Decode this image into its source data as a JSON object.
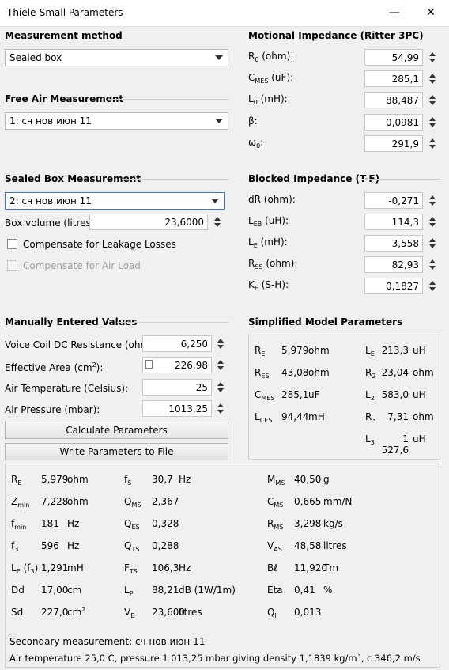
{
  "window": {
    "title": "Thiele-Small Parameters",
    "minimize_glyph": "—",
    "close_glyph": "✕"
  },
  "measurement_method": {
    "header": "Measurement method",
    "selected": "Sealed box"
  },
  "free_air": {
    "header": "Free Air Measurement",
    "selected": "1: сч нов июн 11"
  },
  "sealed_box": {
    "header": "Sealed Box Measurement",
    "selected": "2: сч нов июн 11",
    "box_volume_label": "Box volume (litres):",
    "box_volume_value": "23,6000",
    "compensate_leakage": "Compensate for Leakage Losses",
    "compensate_air": "Compensate for Air Load"
  },
  "motional": {
    "header": "Motional Impedance (Ritter 3PC)",
    "rows": [
      {
        "sym": "R",
        "sub": "0",
        "unit": " (ohm):",
        "value": "54,99"
      },
      {
        "sym": "C",
        "sub": "MES",
        "unit": " (uF):",
        "value": "285,1"
      },
      {
        "sym": "L",
        "sub": "0",
        "unit": " (mH):",
        "value": "88,487"
      },
      {
        "sym": "β:",
        "sub": "",
        "unit": "",
        "value": "0,0981"
      },
      {
        "sym": "ω",
        "sub": "0",
        "unit": ":",
        "value": "291,9"
      }
    ]
  },
  "blocked": {
    "header": "Blocked Impedance (T-F)",
    "rows": [
      {
        "sym": "dR (ohm):",
        "sub": "",
        "unit": "",
        "value": "-0,271"
      },
      {
        "sym": "L",
        "sub": "EB",
        "unit": " (uH):",
        "value": "114,3"
      },
      {
        "sym": "L",
        "sub": "E",
        "unit": " (mH):",
        "value": "3,558"
      },
      {
        "sym": "R",
        "sub": "SS",
        "unit": " (ohm):",
        "value": "82,93"
      },
      {
        "sym": "K",
        "sub": "E",
        "unit": " (S-H):",
        "value": "0,1827"
      }
    ]
  },
  "manual": {
    "header": "Manually Entered Values",
    "rows": [
      {
        "label": "Voice Coil DC Resistance (ohm):",
        "value": "6,250"
      },
      {
        "label_pre": "Effective Area (cm",
        "label_sup": "2",
        "label_post": "):",
        "value": "226,98"
      },
      {
        "label": "Air Temperature (Celsius):",
        "value": "25"
      },
      {
        "label": "Air Pressure (mbar):",
        "value": "1013,25"
      }
    ],
    "calc_button": "Calculate Parameters",
    "write_button": "Write Parameters to File"
  },
  "simplified": {
    "header": "Simplified Model Parameters",
    "left": [
      {
        "sym": "R",
        "sub": "E",
        "value": "5,979",
        "unit": "ohm"
      },
      {
        "sym": "R",
        "sub": "ES",
        "value": "43,08",
        "unit": "ohm"
      },
      {
        "sym": "C",
        "sub": "MES",
        "value": "285,1",
        "unit": "uF"
      },
      {
        "sym": "L",
        "sub": "CES",
        "value": "94,44",
        "unit": "mH"
      }
    ],
    "right": [
      {
        "sym": "L",
        "sub": "E",
        "value": "213,3",
        "unit": "uH"
      },
      {
        "sym": "R",
        "sub": "2",
        "value": "23,04",
        "unit": "ohm"
      },
      {
        "sym": "L",
        "sub": "2",
        "value": "583,0",
        "unit": "uH"
      },
      {
        "sym": "R",
        "sub": "3",
        "value": "7,31",
        "unit": "ohm"
      },
      {
        "sym": "L",
        "sub": "3",
        "value": "1 527,6",
        "unit": "uH"
      }
    ]
  },
  "results": {
    "col1": [
      {
        "sym": "R",
        "sub": "E",
        "value": "5,979",
        "unit": "ohm"
      },
      {
        "sym": "Z",
        "sub": "min",
        "value": "7,228",
        "unit": "ohm"
      },
      {
        "sym": "f",
        "sub": "min",
        "value": "181",
        "unit": "Hz"
      },
      {
        "sym": "f",
        "sub": "3",
        "value": "596",
        "unit": "Hz"
      },
      {
        "sym": "L",
        "sub": "E",
        "extra": " (f",
        "extra_sub": "3",
        "extra_post": ")",
        "value": "1,291",
        "unit": "mH"
      },
      {
        "sym": "Dd",
        "sub": "",
        "value": "17,00",
        "unit": "cm"
      },
      {
        "sym": "Sd",
        "sub": "",
        "value": "227,0",
        "unit": "cm",
        "unit_sup": "2"
      }
    ],
    "col2": [
      {
        "sym": "f",
        "sub": "S",
        "value": "30,7",
        "unit": "Hz"
      },
      {
        "sym": "Q",
        "sub": "MS",
        "value": "2,367",
        "unit": ""
      },
      {
        "sym": "Q",
        "sub": "ES",
        "value": "0,328",
        "unit": ""
      },
      {
        "sym": "Q",
        "sub": "TS",
        "value": "0,288",
        "unit": ""
      },
      {
        "sym": "F",
        "sub": "TS",
        "value": "106,3",
        "unit": "Hz"
      },
      {
        "sym": "L",
        "sub": "P",
        "value": "88,21",
        "unit": "dB (1W/1m)"
      },
      {
        "sym": "V",
        "sub": "B",
        "value": "23,600",
        "unit": "litres"
      }
    ],
    "col3": [
      {
        "sym": "M",
        "sub": "MS",
        "value": "40,50",
        "unit": "g"
      },
      {
        "sym": "C",
        "sub": "MS",
        "value": "0,665",
        "unit": "mm/N"
      },
      {
        "sym": "R",
        "sub": "MS",
        "value": "3,298",
        "unit": "kg/s"
      },
      {
        "sym": "V",
        "sub": "AS",
        "value": "48,58",
        "unit": "litres"
      },
      {
        "sym": "Bℓ",
        "sub": "",
        "value": "11,920",
        "unit": "Tm"
      },
      {
        "sym": "Eta",
        "sub": "",
        "value": "0,41",
        "unit": "%"
      },
      {
        "sym": "Q",
        "sub": "l",
        "value": "0,013",
        "unit": ""
      }
    ],
    "secondary": "Secondary measurement: сч нов июн 11",
    "air_line_pre": "Air temperature 25,0 C, pressure 1 013,25 mbar giving density 1,1839 kg/m",
    "air_line_sup": "3",
    "air_line_post": ", c 346,2 m/s"
  }
}
